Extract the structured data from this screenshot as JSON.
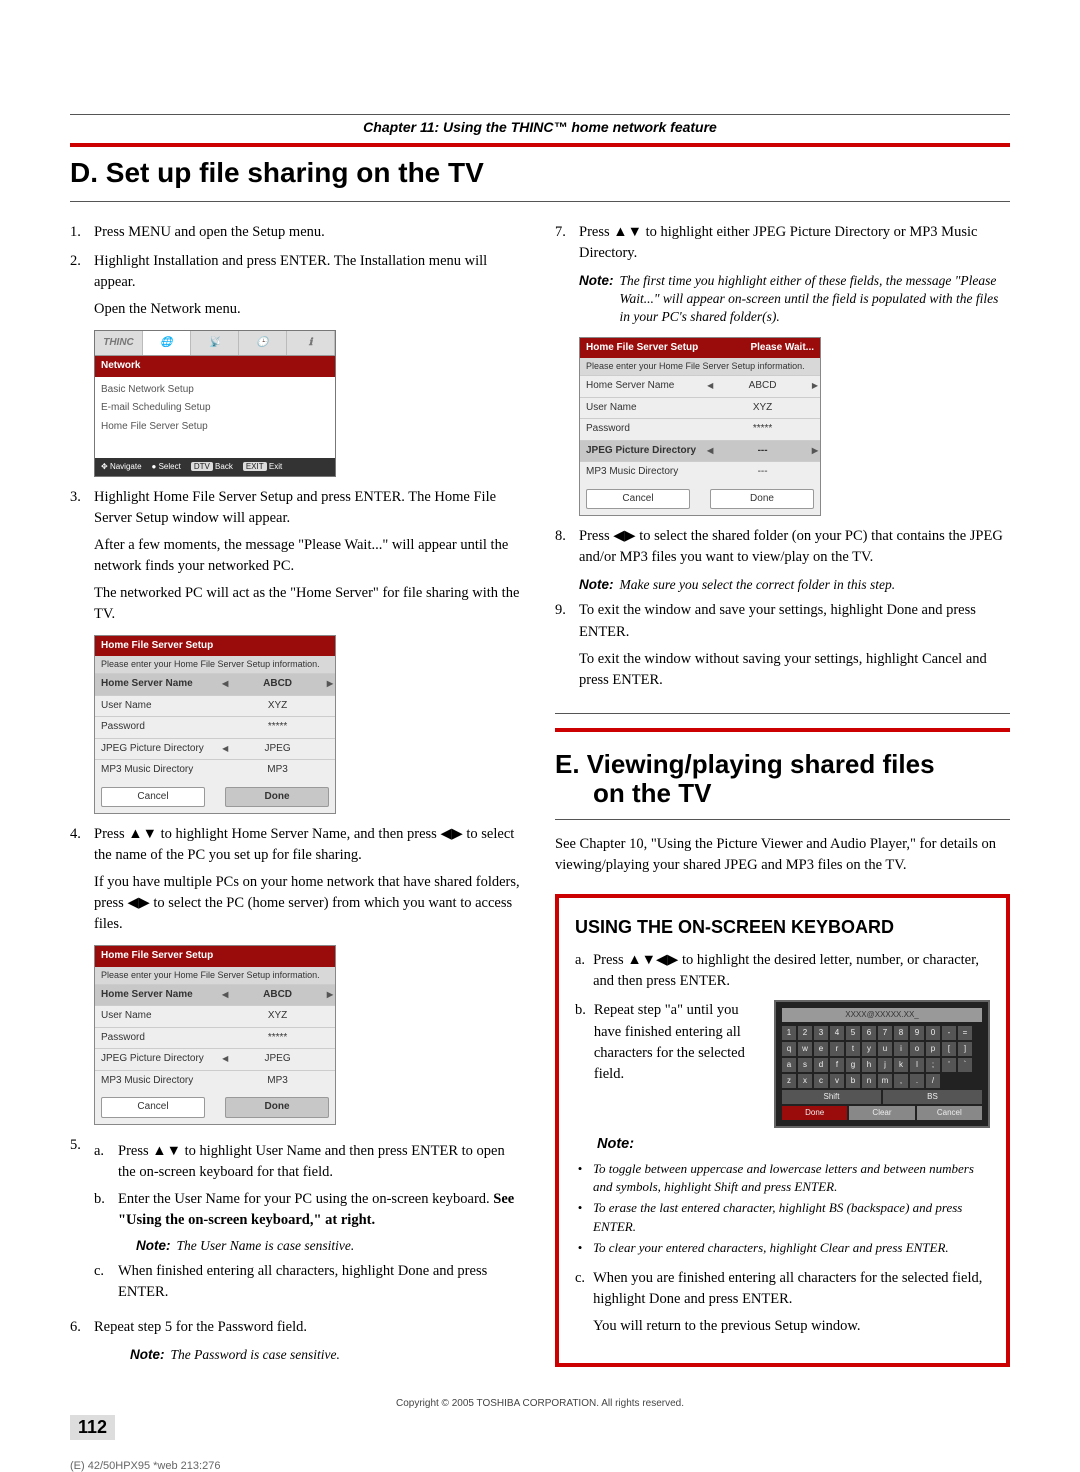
{
  "chapter": "Chapter 11: Using the THINC™ home network feature",
  "sectionD": "D.  Set up file sharing on the TV",
  "sectionE_l1": "E.  Viewing/playing shared files",
  "sectionE_l2": "on the TV",
  "left": {
    "s1": "Press MENU and open the Setup menu.",
    "s2": "Highlight Installation and press ENTER. The Installation menu will appear.",
    "s2b": "Open the Network menu.",
    "s3a": "Highlight Home File Server Setup and press ENTER. The Home File Server Setup window will appear.",
    "s3b": "After a few moments, the message \"Please Wait...\" will appear until the network finds your networked PC.",
    "s3c": "The networked PC will act as the \"Home Server\" for file sharing with the TV.",
    "s4a_pre": "Press ",
    "s4a_mid": " to highlight Home Server Name, and then press ",
    "s4a_post": " to select the name of the PC you set up for file sharing.",
    "s4b_pre": "If you have multiple PCs on your home network that have shared folders, press ",
    "s4b_post": " to select the PC (home server) from which you want to access files.",
    "s5a_a_pre": "Press ",
    "s5a_a_post": " to highlight User Name and then press ENTER to open the on-screen keyboard for that field.",
    "s5a_b": "Enter the User Name for your PC using the on-screen keyboard. ",
    "s5a_b_bold": "See \"Using the on-screen keyboard,\" at right.",
    "s5_note_lbl": "Note:",
    "s5_note": " The User Name is case sensitive.",
    "s5a_c": "When finished entering all characters, highlight Done and press ENTER.",
    "s6": "Repeat step 5 for the Password field.",
    "s6_note_lbl": "Note:",
    "s6_note": " The Password is case sensitive."
  },
  "right": {
    "s7_pre": "Press ",
    "s7_post": " to highlight either JPEG Picture Directory or MP3 Music Directory.",
    "s7_note_lbl": "Note:",
    "s7_note": " The first time you highlight either of these fields, the message \"Please Wait...\" will appear on-screen until the field is populated with the files in your PC's shared folder(s).",
    "s8_pre": "Press ",
    "s8_post": " to select the shared folder (on your PC) that contains the JPEG and/or MP3 files you want to view/play on the TV.",
    "s8_note_lbl": "Note:",
    "s8_note": " Make sure you select the correct folder in this step.",
    "s9a": "To exit the window and save your settings, highlight Done and press ENTER.",
    "s9b": "To exit the window without saving your settings, highlight Cancel and press ENTER.",
    "e_para": "See Chapter 10, \"Using the Picture Viewer and Audio Player,\" for details on viewing/playing your shared JPEG and MP3 files on the TV."
  },
  "panel": {
    "title": "Home File Server Setup",
    "please_wait": "Please Wait...",
    "sub": "Please enter your Home File Server Setup information.",
    "rows": [
      {
        "l": "Home Server Name",
        "r": "ABCD"
      },
      {
        "l": "User Name",
        "r": "XYZ"
      },
      {
        "l": "Password",
        "r": "*****"
      },
      {
        "l": "JPEG Picture Directory",
        "r": "JPEG"
      },
      {
        "l": "MP3 Music Directory",
        "r": "MP3"
      }
    ],
    "rows_wait": [
      {
        "l": "Home Server Name",
        "r": "ABCD"
      },
      {
        "l": "User Name",
        "r": "XYZ"
      },
      {
        "l": "Password",
        "r": "*****"
      },
      {
        "l": "JPEG Picture Directory",
        "r": "---"
      },
      {
        "l": "MP3 Music Directory",
        "r": "---"
      }
    ],
    "cancel": "Cancel",
    "done": "Done"
  },
  "net": {
    "icon": "THINC",
    "title": "Network",
    "items": [
      "Basic Network Setup",
      "E-mail Scheduling Setup",
      "Home File Server Setup"
    ],
    "nav": "Navigate",
    "sel": "Select",
    "back": "Back",
    "exit": "Exit",
    "back_key": "DTV",
    "exit_key": "EXIT"
  },
  "kbd": {
    "title": "USING THE ON-SCREEN KEYBOARD",
    "a_pre": "Press ",
    "a_post": "  to highlight the desired letter, number, or character, and then press ENTER.",
    "b": "Repeat step \"a\" until you have finished entering all characters for the selected field.",
    "note_lbl": "Note:",
    "n1": "To toggle between uppercase and lowercase letters and between numbers and symbols, highlight Shift and press ENTER.",
    "n2": "To erase the last entered character, highlight BS (backspace) and press ENTER.",
    "n3": "To clear your entered characters, highlight Clear and press ENTER.",
    "c": "When you are finished entering all characters for the selected field, highlight Done and press ENTER.",
    "c2": "You will return to the previous Setup window.",
    "osk": {
      "display": "XXXX@XXXXX.XX_",
      "row1": [
        "1",
        "2",
        "3",
        "4",
        "5",
        "6",
        "7",
        "8",
        "9",
        "0",
        "-",
        "="
      ],
      "row2": [
        "q",
        "w",
        "e",
        "r",
        "t",
        "y",
        "u",
        "i",
        "o",
        "p",
        "[",
        "]"
      ],
      "row3": [
        "a",
        "s",
        "d",
        "f",
        "g",
        "h",
        "j",
        "k",
        "l",
        ";",
        "'",
        "`"
      ],
      "row4": [
        "z",
        "x",
        "c",
        "v",
        "b",
        "n",
        "m",
        ",",
        ".",
        "/"
      ],
      "shift": "Shift",
      "bs": "BS",
      "done": "Done",
      "clear": "Clear",
      "cancel": "Cancel"
    }
  },
  "footer": {
    "copyright": "Copyright © 2005 TOSHIBA CORPORATION.  All rights reserved.",
    "page": "112",
    "crop": "(E) 42/50HPX95 *web 213:276"
  },
  "glyph": {
    "ud": "▲▼",
    "lr": "◀▶",
    "all4": "▲▼◀▶"
  }
}
